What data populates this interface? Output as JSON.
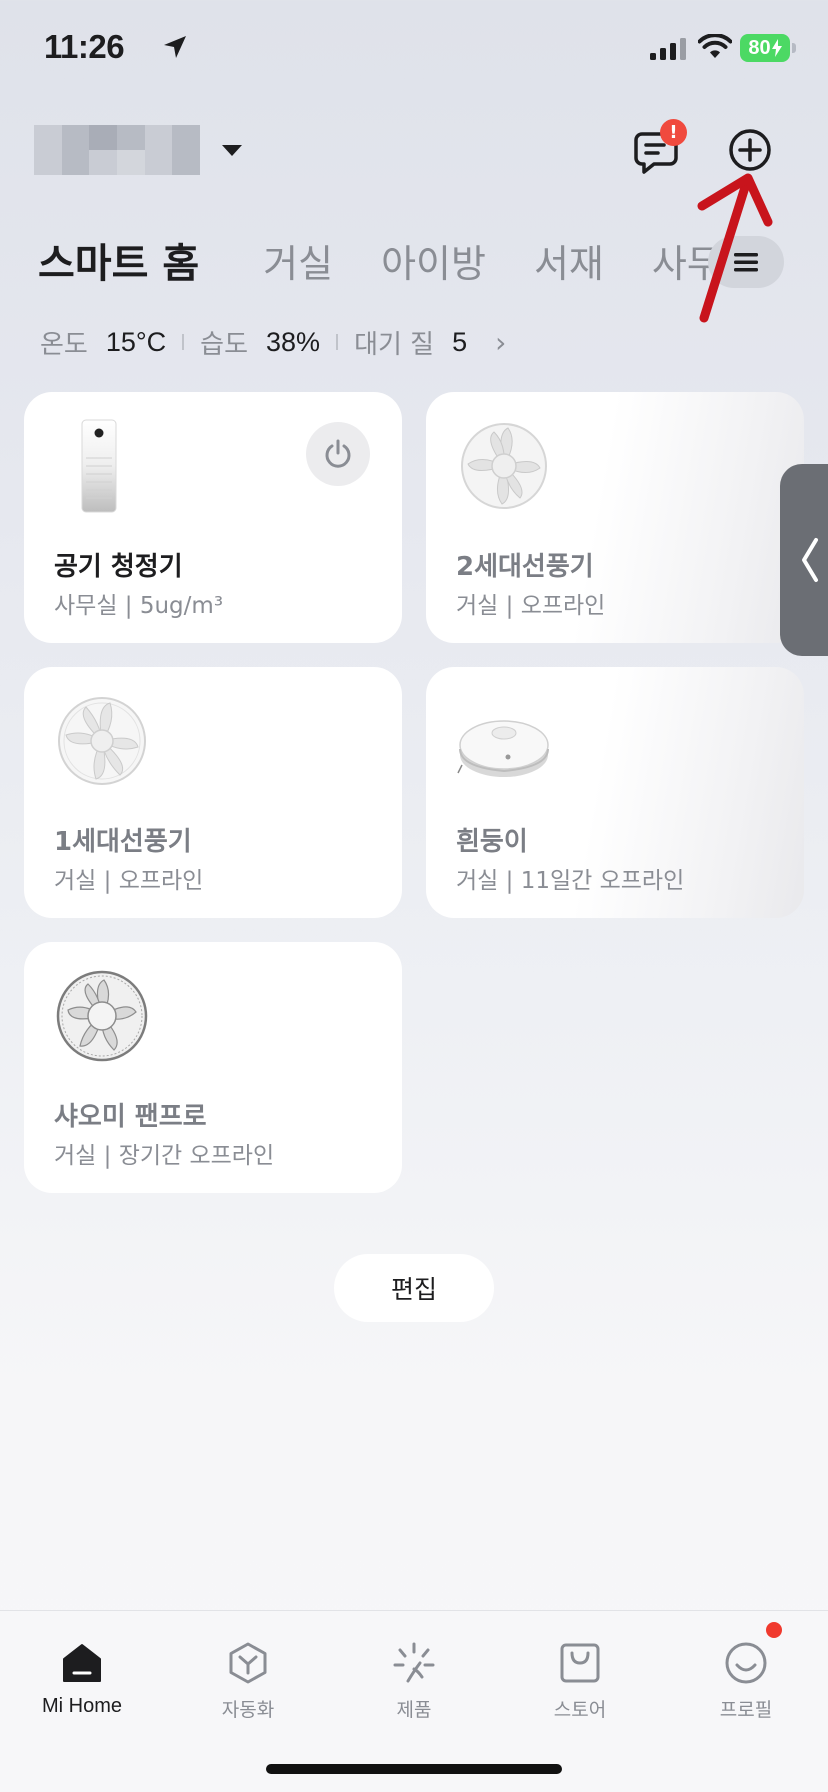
{
  "status_bar": {
    "time": "11:26",
    "battery": "80"
  },
  "header": {
    "message_badge": "!",
    "icons": [
      "message-icon",
      "add-device-icon",
      "location-arrow-icon",
      "signal-icon",
      "wifi-icon"
    ]
  },
  "rooms": {
    "tabs": [
      "스마트 홈",
      "거실",
      "아이방",
      "서재",
      "사무"
    ],
    "active_index": 0
  },
  "environment": {
    "temp_label": "온도",
    "temp_value": "15°C",
    "humidity_label": "습도",
    "humidity_value": "38%",
    "air_label": "대기 질",
    "air_value": "5"
  },
  "devices": [
    {
      "name": "공기 청정기",
      "sub": "사무실 | 5ug/m³",
      "icon": "air-purifier-icon",
      "online": true
    },
    {
      "name": "2세대선풍기",
      "sub": "거실 | 오프라인",
      "icon": "fan-icon",
      "online": false
    },
    {
      "name": "1세대선풍기",
      "sub": "거실 | 오프라인",
      "icon": "fan-icon",
      "online": false
    },
    {
      "name": "흰둥이",
      "sub": "거실 | 11일간 오프라인",
      "icon": "robot-vacuum-icon",
      "online": false
    },
    {
      "name": "샤오미 팬프로",
      "sub": "거실 | 장기간 오프라인",
      "icon": "fan-pro-icon",
      "online": false
    }
  ],
  "edit_label": "편집",
  "bottom_tabs": [
    {
      "label": "Mi Home",
      "icon": "home-icon"
    },
    {
      "label": "자동화",
      "icon": "automation-icon"
    },
    {
      "label": "제품",
      "icon": "products-icon"
    },
    {
      "label": "스토어",
      "icon": "store-icon"
    },
    {
      "label": "프로필",
      "icon": "profile-icon"
    }
  ],
  "colors": {
    "accent_red": "#f04a3e",
    "annotation_arrow": "#c8141c",
    "battery_green": "#4cd964"
  }
}
